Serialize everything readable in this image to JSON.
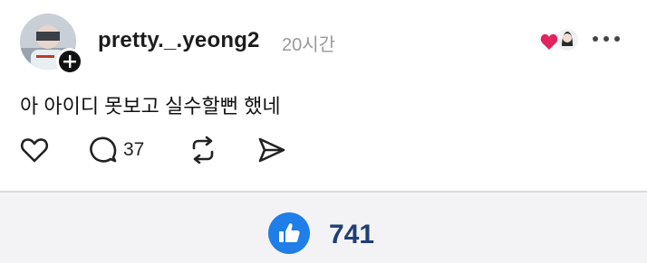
{
  "post": {
    "username": "pretty._.yeong2",
    "timestamp": "20시간",
    "text": "아 아이디 못보고 실수할뻔 했네",
    "reply_count": "37"
  },
  "footer": {
    "like_count": "741"
  },
  "icons": {
    "avatar": "profile-photo",
    "follow": "plus-icon",
    "liked_by": "heart-with-avatar-icon",
    "more": "more-dots-icon",
    "like": "heart-outline-icon",
    "reply": "comment-bubble-icon",
    "repost": "repost-arrows-icon",
    "share": "send-icon",
    "thumbs": "thumbs-up-icon"
  },
  "colors": {
    "heart_red": "#e0245e",
    "like_blue": "#1f7ee8",
    "like_count": "#1f3f74",
    "timestamp": "#9a9a9a"
  }
}
